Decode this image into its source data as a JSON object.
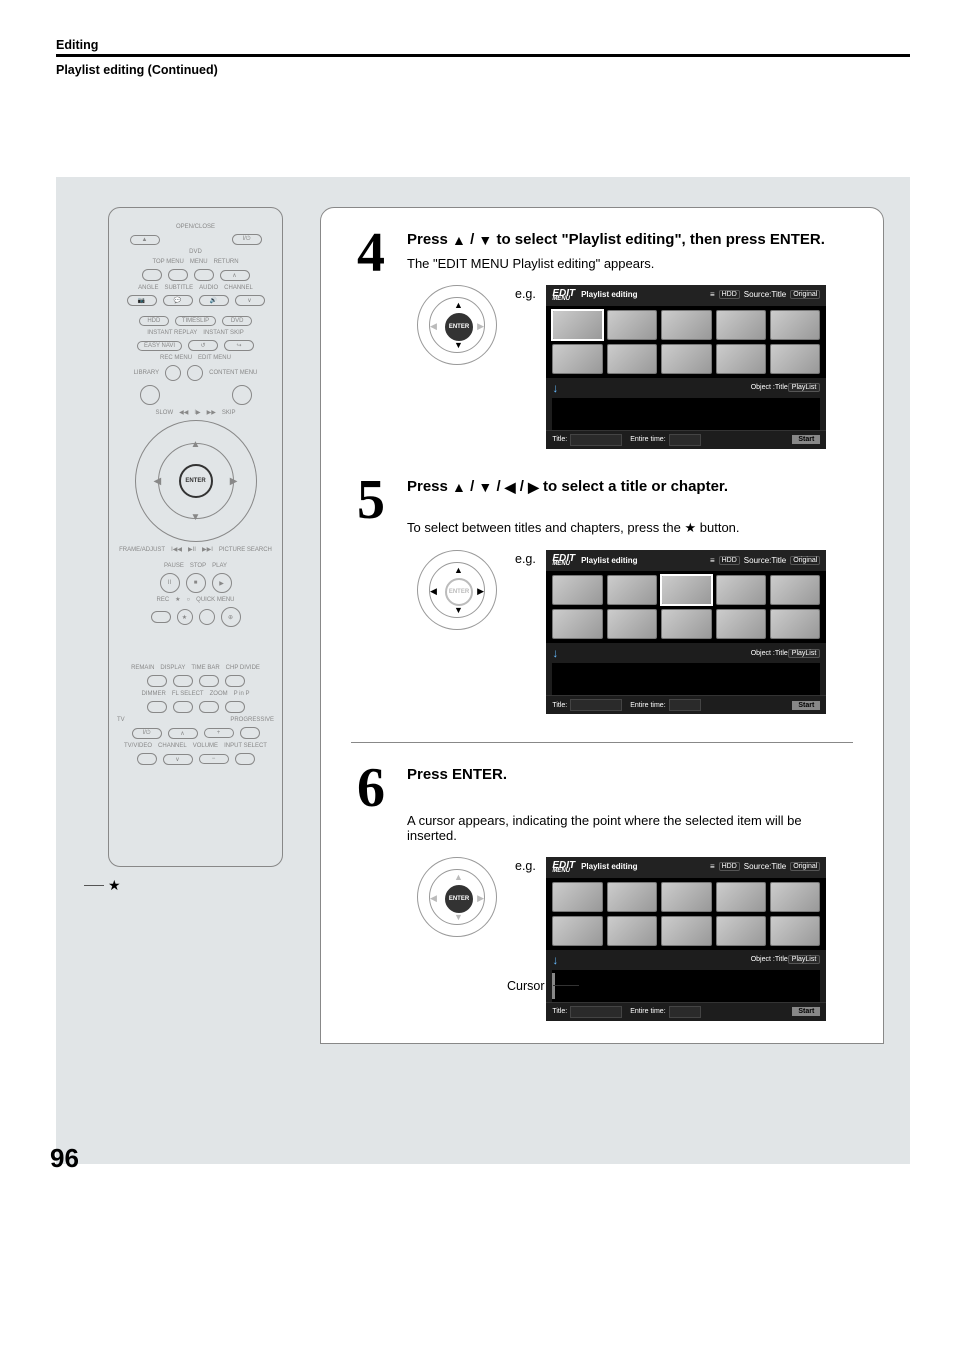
{
  "header": {
    "section": "Editing",
    "subtitle": "Playlist editing (Continued)"
  },
  "page_number": "96",
  "remote": {
    "open_close": "OPEN/CLOSE",
    "dvd": "DVD",
    "top_menu": "TOP MENU",
    "menu": "MENU",
    "return": "RETURN",
    "angle": "ANGLE",
    "subtitle": "SUBTITLE",
    "audio": "AUDIO",
    "channel": "CHANNEL",
    "hdd": "HDD",
    "timeslip": "TIMESLIP",
    "dvd2": "DVD",
    "instant_replay": "INSTANT REPLAY",
    "instant_skip": "INSTANT SKIP",
    "easy_navi": "EASY NAVI",
    "rec_menu": "REC MENU",
    "edit_menu": "EDIT MENU",
    "library": "LIBRARY",
    "content_menu": "CONTENT MENU",
    "slow": "SLOW",
    "skip": "SKIP",
    "enter": "ENTER",
    "frame_adjust": "FRAME/ADJUST",
    "picture_search": "PICTURE SEARCH",
    "pause": "PAUSE",
    "stop": "STOP",
    "play": "PLAY",
    "rec": "REC",
    "quick_menu": "QUICK MENU",
    "remain": "REMAIN",
    "display": "DISPLAY",
    "time_bar": "TIME BAR",
    "chp_divide": "CHP DIVIDE",
    "dimmer": "DIMMER",
    "fl_select": "FL SELECT",
    "zoom": "ZOOM",
    "p_in_p": "P in P",
    "tv": "TV",
    "progressive": "PROGRESSIVE",
    "tv_video": "TV/VIDEO",
    "channel2": "CHANNEL",
    "volume": "VOLUME",
    "input_select": "INPUT SELECT"
  },
  "steps": {
    "s4": {
      "num": "4",
      "title_a": "Press ",
      "title_b": " / ",
      "title_c": " to select \"Playlist editing\", then press ENTER.",
      "desc": "The \"EDIT MENU Playlist editing\" appears.",
      "eg": "e.g.",
      "enter": "ENTER"
    },
    "s5": {
      "num": "5",
      "title_a": "Press ",
      "title_b": " / ",
      "title_c": " / ",
      "title_d": " / ",
      "title_e": " to select a title or chapter.",
      "desc_a": "To select between titles and chapters, press the ",
      "desc_b": " button.",
      "eg": "e.g.",
      "enter": "ENTER"
    },
    "s6": {
      "num": "6",
      "title": "Press ENTER.",
      "desc": "A cursor appears, indicating the point where the selected item will be inserted.",
      "eg": "e.g.",
      "enter": "ENTER",
      "cursor": "Cursor"
    }
  },
  "screen": {
    "edit": "EDIT",
    "menu": "MENU",
    "title": "Playlist editing",
    "hdd": "HDD",
    "source_title": "Source:Title",
    "original": "Original",
    "object_title": "Object :Title",
    "playlist": "PlayList",
    "title_lbl": "Title:",
    "entire_time": "Entire time:",
    "start": "Start",
    "arrow": "↓"
  }
}
